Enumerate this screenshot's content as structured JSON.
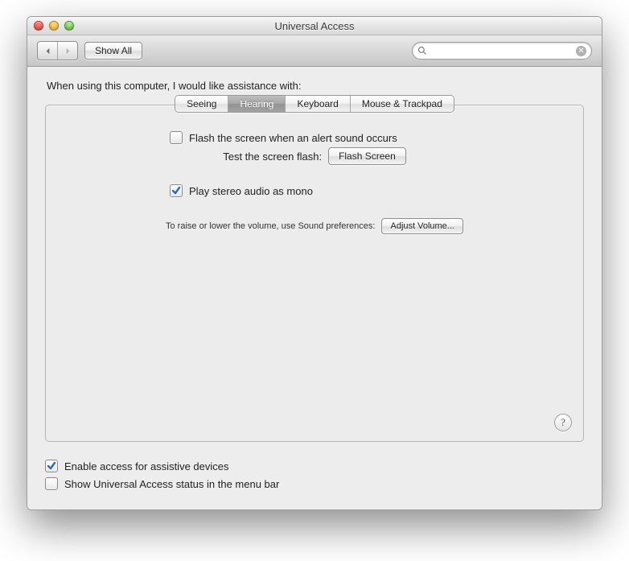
{
  "window": {
    "title": "Universal Access"
  },
  "toolbar": {
    "show_all": "Show All",
    "search_value": "",
    "search_placeholder": ""
  },
  "intro": "When using this computer, I would like assistance with:",
  "tabs": [
    {
      "label": "Seeing",
      "active": false
    },
    {
      "label": "Hearing",
      "active": true
    },
    {
      "label": "Keyboard",
      "active": false
    },
    {
      "label": "Mouse & Trackpad",
      "active": false
    }
  ],
  "hearing": {
    "flash_label": "Flash the screen when an alert sound occurs",
    "flash_checked": false,
    "test_label": "Test the screen flash:",
    "flash_button": "Flash Screen",
    "mono_label": "Play stereo audio as mono",
    "mono_checked": true,
    "volume_hint": "To raise or lower the volume, use Sound preferences:",
    "adjust_button": "Adjust Volume..."
  },
  "footer": {
    "assistive_label": "Enable access for assistive devices",
    "assistive_checked": true,
    "menubar_label": "Show Universal Access status in the menu bar",
    "menubar_checked": false
  },
  "help_glyph": "?"
}
